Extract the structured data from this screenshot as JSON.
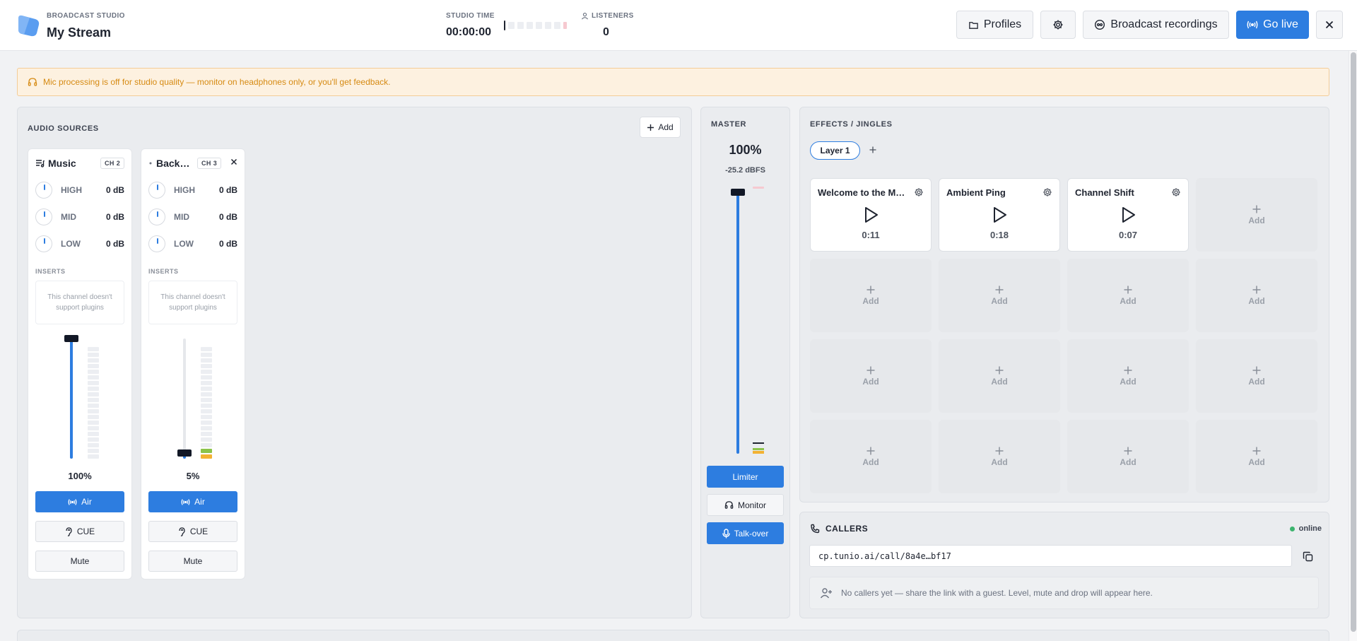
{
  "header": {
    "brand_kicker": "BROADCAST STUDIO",
    "title": "My Stream",
    "studio_time_label": "STUDIO TIME",
    "studio_time": "00:00:00",
    "listeners_label": "LISTENERS",
    "listeners": "0",
    "profiles_label": "Profiles",
    "recordings_label": "Broadcast recordings",
    "go_live_label": "Go live",
    "accent": "#2d7de0"
  },
  "banner": {
    "text": "Mic processing is off for studio quality — monitor on headphones only, or you'll get feedback.",
    "color": "#d68a12"
  },
  "sources": {
    "title": "AUDIO SOURCES",
    "add_label": "Add",
    "inserts_label": "INSERTS",
    "channels": [
      {
        "name": "Music",
        "badge": "CH 2",
        "icon": "playlist-icon",
        "eq": [
          {
            "band": "HIGH",
            "value": "0 dB"
          },
          {
            "band": "MID",
            "value": "0 dB"
          },
          {
            "band": "LOW",
            "value": "0 dB"
          }
        ],
        "inserts_text": "This channel doesn't support plugins",
        "level": 1.0,
        "level_text": "100%",
        "air_label": "Air",
        "cue_label": "CUE",
        "mute_label": "Mute"
      },
      {
        "name": "Back…",
        "badge": "CH 3",
        "icon": "dot-icon",
        "eq": [
          {
            "band": "HIGH",
            "value": "0 dB"
          },
          {
            "band": "MID",
            "value": "0 dB"
          },
          {
            "band": "LOW",
            "value": "0 dB"
          }
        ],
        "inserts_text": "This channel doesn't support plugins",
        "level": 0.05,
        "level_text": "5%",
        "air_label": "Air",
        "cue_label": "CUE",
        "mute_label": "Mute"
      }
    ]
  },
  "master": {
    "title": "MASTER",
    "level_text": "100%",
    "dbfs": "-25.2 dBFS",
    "level": 1.0,
    "limiter_label": "Limiter",
    "monitor_label": "Monitor",
    "talkover_label": "Talk-over"
  },
  "effects": {
    "title": "EFFECTS / JINGLES",
    "layer_label": "Layer 1",
    "add_label": "Add",
    "pads": [
      {
        "title": "Welcome to the Ma…",
        "time": "0:11"
      },
      {
        "title": "Ambient Ping",
        "time": "0:18"
      },
      {
        "title": "Channel Shift",
        "time": "0:07"
      }
    ]
  },
  "callers": {
    "title": "CALLERS",
    "status": "online",
    "link": "cp.tunio.ai/call/8a4e…bf17",
    "empty_text": "No callers yet — share the link with a guest. Level, mute and drop will appear here."
  }
}
